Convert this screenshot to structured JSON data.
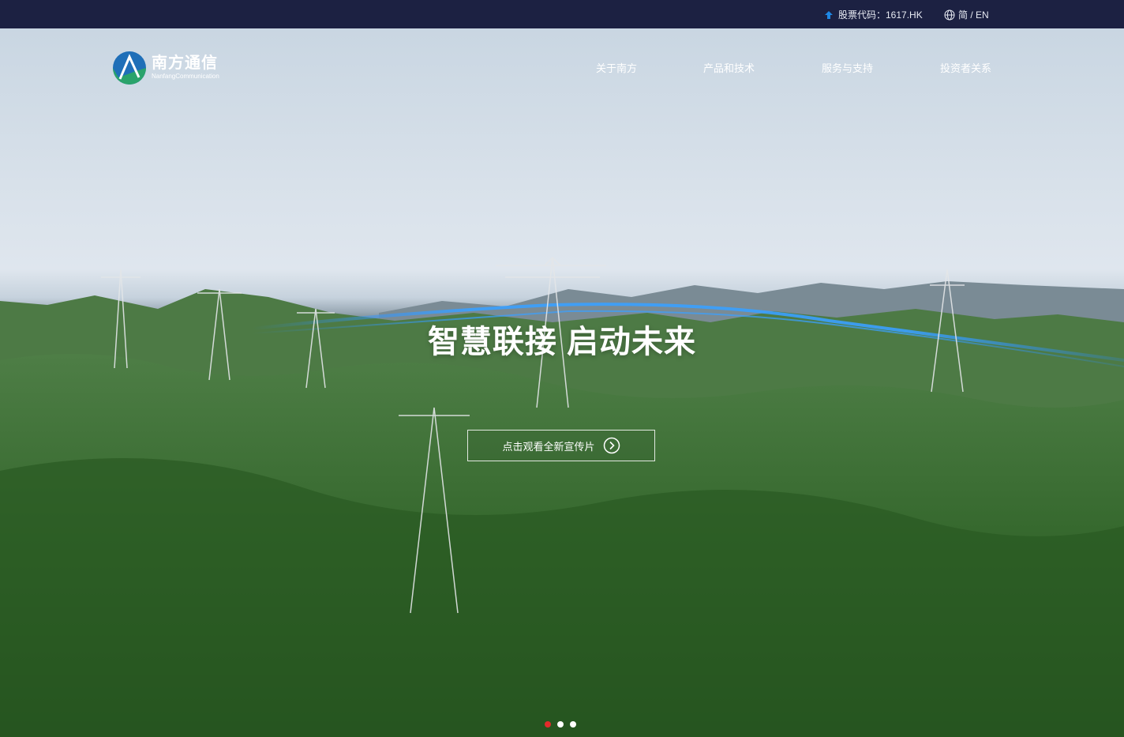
{
  "topbar": {
    "stock_label": "股票代码：1617.HK",
    "language_label": "简 / EN"
  },
  "logo": {
    "name_cn": "南方通信",
    "name_en": "NanfangCommunication"
  },
  "nav": {
    "items": [
      "关于南方",
      "产品和技术",
      "服务与支持",
      "投资者关系"
    ]
  },
  "hero": {
    "headline": "智慧联接  启动未来",
    "cta_label": "点击观看全新宣传片"
  },
  "carousel": {
    "count": 3,
    "active_index": 0
  },
  "colors": {
    "topbar": "#1c2142",
    "accent_red": "#e22b2b",
    "accent_blue": "#1e88e5"
  }
}
